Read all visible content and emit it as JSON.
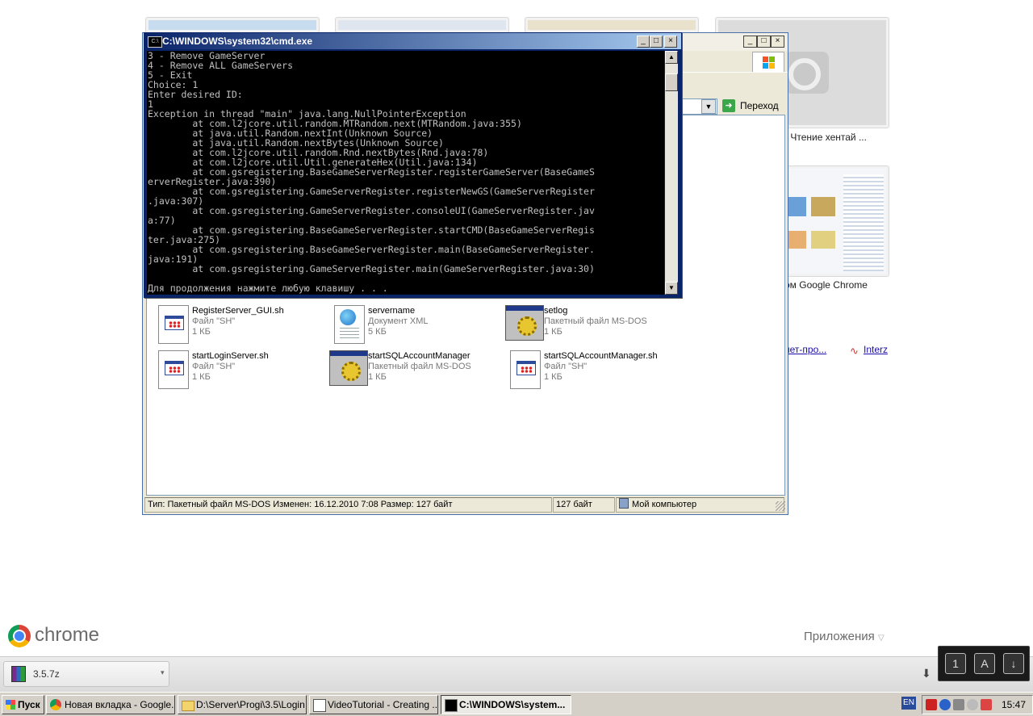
{
  "chrome_newtab": {
    "thumbnail_captions": [
      "- Чтение хентай ...",
      "ом Google Chrome"
    ],
    "link_texts": [
      "нет-про...",
      "Interz"
    ],
    "chrome_word": "chrome",
    "apps_label": "Приложения"
  },
  "download_bar": {
    "item_label": "3.5.7z",
    "dropdown_glyph": "▾",
    "down_glyph": "⬇"
  },
  "floating_toolbar": {
    "buttons": [
      "1",
      "A",
      "↓"
    ]
  },
  "explorer": {
    "address_dropdown_glyph": "▼",
    "go_label": "Переход",
    "files": [
      {
        "name": "RegisterServer_GUI.sh",
        "type": "Файл \"SH\"",
        "size": "1 КБ",
        "icon": "sh-file-icon"
      },
      {
        "name": "servername",
        "type": "Документ XML",
        "size": "5 КБ",
        "icon": "xml-file-icon"
      },
      {
        "name": "setlog",
        "type": "Пакетный файл MS-DOS",
        "size": "1 КБ",
        "icon": "batch-file-icon"
      },
      {
        "name": "startLoginServer.sh",
        "type": "Файл \"SH\"",
        "size": "1 КБ",
        "icon": "sh-file-icon"
      },
      {
        "name": "startSQLAccountManager",
        "type": "Пакетный файл MS-DOS",
        "size": "1 КБ",
        "icon": "batch-file-icon"
      },
      {
        "name": "startSQLAccountManager.sh",
        "type": "Файл \"SH\"",
        "size": "1 КБ",
        "icon": "sh-file-icon"
      }
    ],
    "status": {
      "info": "Тип: Пакетный файл MS-DOS Изменен: 16.12.2010 7:08 Размер: 127 байт",
      "size": "127 байт",
      "location": "Мой компьютер"
    },
    "window_buttons": [
      "_",
      "□",
      "×"
    ]
  },
  "cmd": {
    "title": "C:\\WINDOWS\\system32\\cmd.exe",
    "window_buttons": [
      "_",
      "□",
      "×"
    ],
    "scroll_up": "▲",
    "scroll_down": "▼",
    "lines": [
      "3 - Remove GameServer",
      "4 - Remove ALL GameServers",
      "5 - Exit",
      "Choice: 1",
      "Enter desired ID:",
      "1",
      "Exception in thread \"main\" java.lang.NullPointerException",
      "        at com.l2jcore.util.random.MTRandom.next(MTRandom.java:355)",
      "        at java.util.Random.nextInt(Unknown Source)",
      "        at java.util.Random.nextBytes(Unknown Source)",
      "        at com.l2jcore.util.random.Rnd.nextBytes(Rnd.java:78)",
      "        at com.l2jcore.util.Util.generateHex(Util.java:134)",
      "        at com.gsregistering.BaseGameServerRegister.registerGameServer(BaseGameS",
      "erverRegister.java:390)",
      "        at com.gsregistering.GameServerRegister.registerNewGS(GameServerRegister",
      ".java:307)",
      "        at com.gsregistering.GameServerRegister.consoleUI(GameServerRegister.jav",
      "a:77)",
      "        at com.gsregistering.BaseGameServerRegister.startCMD(BaseGameServerRegis",
      "ter.java:275)",
      "        at com.gsregistering.BaseGameServerRegister.main(BaseGameServerRegister.",
      "java:191)",
      "        at com.gsregistering.GameServerRegister.main(GameServerRegister.java:30)",
      "",
      "Для продолжения нажмите любую клавишу . . ."
    ]
  },
  "taskbar": {
    "start_label": "Пуск",
    "tasks": [
      {
        "label": "Новая вкладка - Google...",
        "icon": "chrome-icon"
      },
      {
        "label": "D:\\Server\\Progi\\3.5\\Login",
        "icon": "folder-icon"
      },
      {
        "label": "VideoTutorial - Creating ...",
        "icon": "document-icon"
      },
      {
        "label": "C:\\WINDOWS\\system...",
        "icon": "cmd-icon"
      }
    ],
    "language": "EN",
    "clock": "15:47"
  }
}
